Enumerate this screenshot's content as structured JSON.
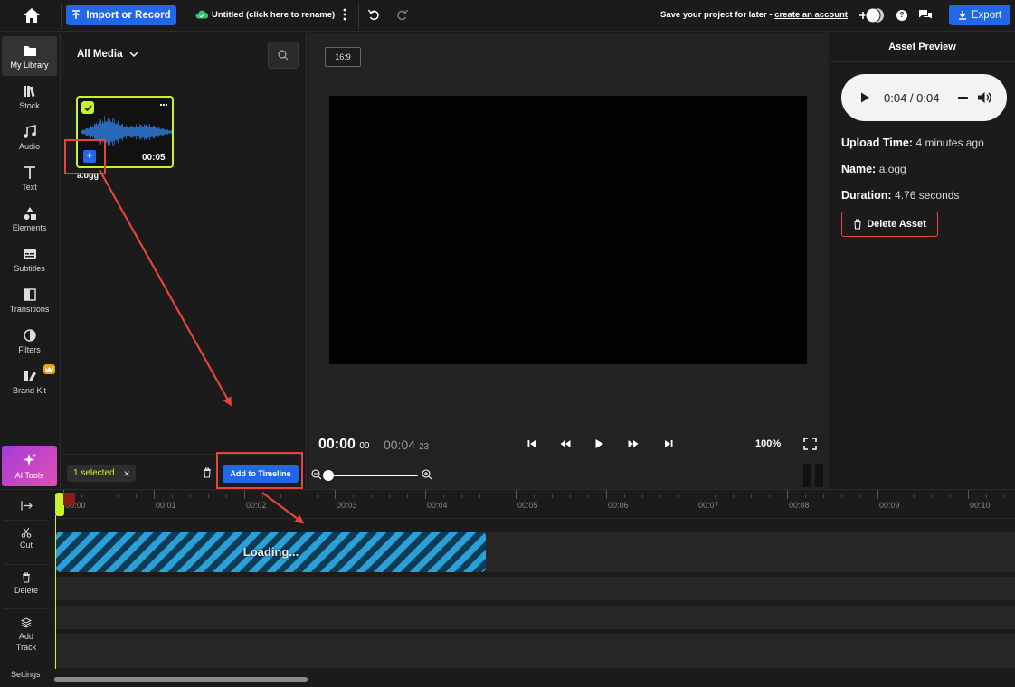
{
  "topbar": {
    "import_label": "Import or Record",
    "project_title": "Untitled (click here to rename)",
    "save_prompt": "Save your project for later - ",
    "create_account": "create an account",
    "help_glyph": "?",
    "export_label": "Export",
    "icons": [
      "home-icon",
      "upload-icon",
      "cloud-icon",
      "more-vertical-icon",
      "undo-icon",
      "redo-icon",
      "add-user-icon",
      "help-icon",
      "chat-icon",
      "download-icon"
    ]
  },
  "nav": {
    "items": [
      {
        "label": "My Library",
        "icon": "folder-icon",
        "active": true
      },
      {
        "label": "Stock",
        "icon": "stock-icon"
      },
      {
        "label": "Audio",
        "icon": "music-icon"
      },
      {
        "label": "Text",
        "icon": "text-icon"
      },
      {
        "label": "Elements",
        "icon": "shapes-icon"
      },
      {
        "label": "Subtitles",
        "icon": "subtitles-icon"
      },
      {
        "label": "Transitions",
        "icon": "transition-icon"
      },
      {
        "label": "Filters",
        "icon": "filter-icon"
      },
      {
        "label": "Brand Kit",
        "icon": "brand-kit-icon"
      }
    ],
    "ai_tools": "AI Tools"
  },
  "library": {
    "filter_label": "All Media",
    "media": {
      "name": "a.ogg",
      "duration": "00:05",
      "plus_glyph": "+"
    },
    "selected_text": "1 selected",
    "clear_glyph": "×",
    "add_to_timeline": "Add to Timeline"
  },
  "preview": {
    "aspect_ratio": "16:9",
    "current_time": "00:00",
    "current_frames": "00",
    "total_time": "00:04",
    "total_frames": "23",
    "zoom": "100%",
    "zoom_slider_value": 0.0
  },
  "asset": {
    "title": "Asset Preview",
    "player_time": "0:04 / 0:04",
    "upload_label": "Upload Time:",
    "upload_value": "4 minutes ago",
    "name_label": "Name:",
    "name_value": "a.ogg",
    "duration_label": "Duration:",
    "duration_value": "4.76 seconds",
    "delete_label": "Delete Asset"
  },
  "timeline": {
    "tools": {
      "cut": "Cut",
      "delete": "Delete",
      "add_track": "Add Track",
      "settings": "Settings"
    },
    "ticks": [
      "00:00",
      "00:01",
      "00:02",
      "00:03",
      "00:04",
      "00:05",
      "00:06",
      "00:07",
      "00:08",
      "00:09",
      "00:10"
    ],
    "loading_text": "Loading..."
  },
  "colors": {
    "accent_blue": "#2167e6",
    "selection_lime": "#c6f32b",
    "annotation_red": "#e2463a",
    "background": "#1b1b1b"
  }
}
